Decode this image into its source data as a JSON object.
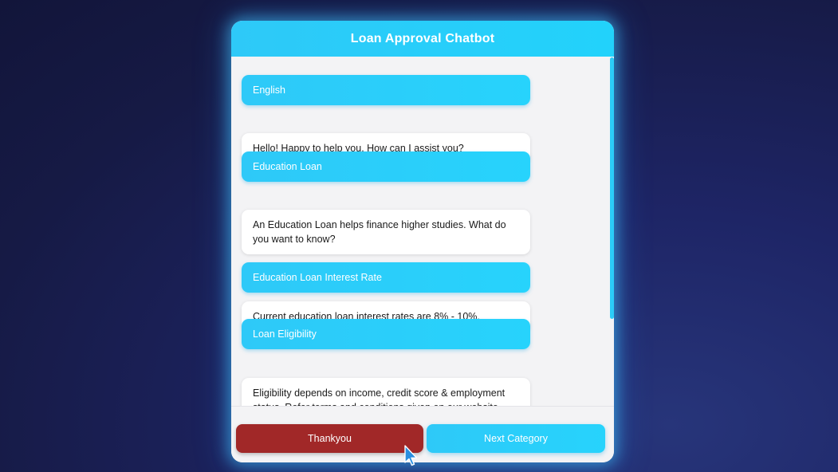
{
  "header": {
    "title": "Loan Approval Chatbot"
  },
  "messages": [
    {
      "sender": "user",
      "text": "English"
    },
    {
      "sender": "bot",
      "text": "Hello! Happy to help you. How can I assist you?"
    },
    {
      "sender": "user",
      "text": "Education Loan"
    },
    {
      "sender": "bot",
      "text": "An Education Loan helps finance higher studies. What do you want to know?"
    },
    {
      "sender": "user",
      "text": "Education Loan Interest Rate"
    },
    {
      "sender": "bot",
      "text": "Current education loan interest rates are 8% - 10%."
    },
    {
      "sender": "user",
      "text": "Loan Eligibility"
    },
    {
      "sender": "bot",
      "text": "Eligibility depends on income, credit score & employment status. Refer terms and conditions given on our website."
    }
  ],
  "footer": {
    "thankyou_label": "Thankyou",
    "next_category_label": "Next Category"
  },
  "colors": {
    "accent": "#2ec9f8",
    "thankyou_button": "#a12828",
    "background": "#1a1f50"
  },
  "icons": {
    "cursor": "mouse-pointer-icon"
  }
}
